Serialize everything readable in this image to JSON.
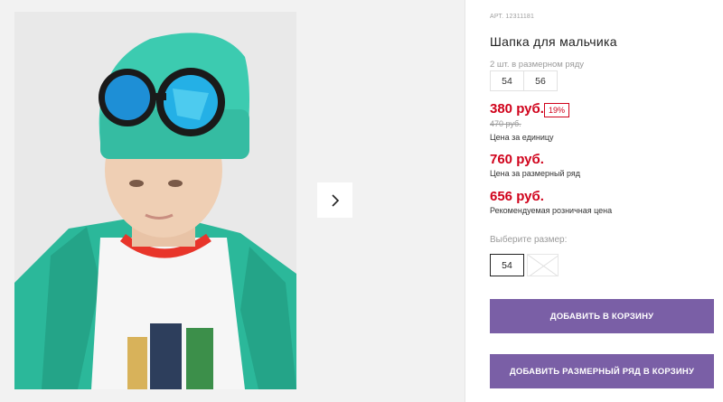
{
  "product": {
    "article_label": "АРТ. 12311181",
    "title": "Шапка для мальчика"
  },
  "row_sizes": {
    "note": "2 шт. в размерном ряду",
    "sizes": [
      "54",
      "56"
    ]
  },
  "pricing": {
    "unit_price": "380 руб.",
    "discount": "19%",
    "old_price": "470 руб.",
    "unit_caption": "Цена за единицу",
    "row_price": "760 руб.",
    "row_caption": "Цена за размерный ряд",
    "rrp_price": "656 руб.",
    "rrp_caption": "Рекомендуемая розничная цена"
  },
  "size_select": {
    "label": "Выберите размер:",
    "selected": "54"
  },
  "buttons": {
    "add_to_cart": "ДОБАВИТЬ В КОРЗИНУ",
    "add_row_to_cart": "ДОБАВИТЬ РАЗМЕРНЫЙ РЯД В КОРЗИНУ"
  },
  "colors": {
    "price_red": "#d0021b",
    "button_purple": "#7a5fa6",
    "hat_teal": "#2ec4a6"
  },
  "icons": {
    "next": "chevron-right-icon"
  }
}
